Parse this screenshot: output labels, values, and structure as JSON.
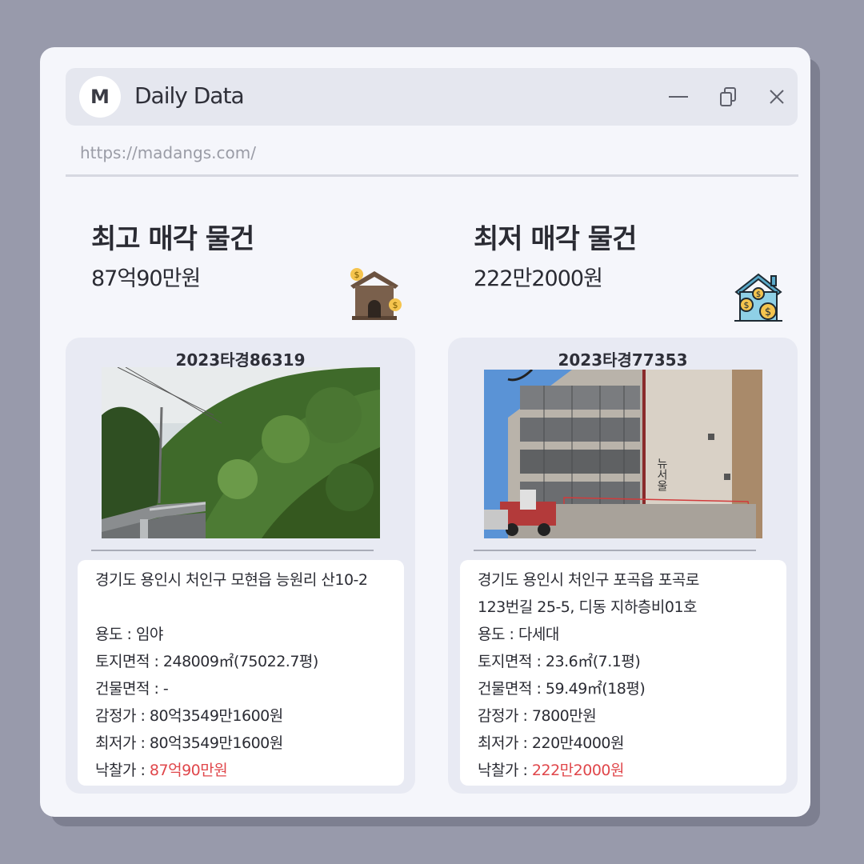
{
  "window": {
    "logo_letter": "M",
    "title": "Daily Data",
    "url": "https://madangs.com/",
    "controls": [
      "minimize-icon",
      "restore-icon",
      "close-icon"
    ]
  },
  "left": {
    "heading": "최고 매각 물건",
    "price": "87억90만원",
    "icon": "house-money-icon",
    "case_no": "2023타경86319",
    "photo": "forest-hillside-road-photo",
    "address_line1": "경기도 용인시 처인구 모현읍 능원리 산10-2",
    "address_line2": "",
    "usage": "용도 : 임야",
    "land_area": "토지면적 : 248009㎡(75022.7평)",
    "building_area": "건물면적 : -",
    "appraisal": "감정가 : 80억3549만1600원",
    "minimum": "최저가 : 80억3549만1600원",
    "winning_label": "낙찰가 : ",
    "winning_value": "87억90만원"
  },
  "right": {
    "heading": "최저 매각 물건",
    "price": "222만2000원",
    "icon": "house-coins-icon",
    "case_no": "2023타경77353",
    "photo": "apartment-building-photo",
    "address_line1": "경기도 용인시 처인구 포곡읍 포곡로",
    "address_line2": "123번길 25-5, 디동 지하층비01호",
    "usage": "용도 :  다세대",
    "land_area": "토지면적 : 23.6㎡(7.1평)",
    "building_area": "건물면적 : 59.49㎡(18평)",
    "appraisal": "감정가 : 7800만원",
    "minimum": "최저가 : 220만4000원",
    "winning_label": "낙찰가 : ",
    "winning_value": "222만2000원"
  },
  "colors": {
    "background": "#989aab",
    "window": "#f5f6fb",
    "titlebar": "#e5e7ef",
    "card": "#e8eaf3",
    "accent_red": "#e0474b"
  }
}
